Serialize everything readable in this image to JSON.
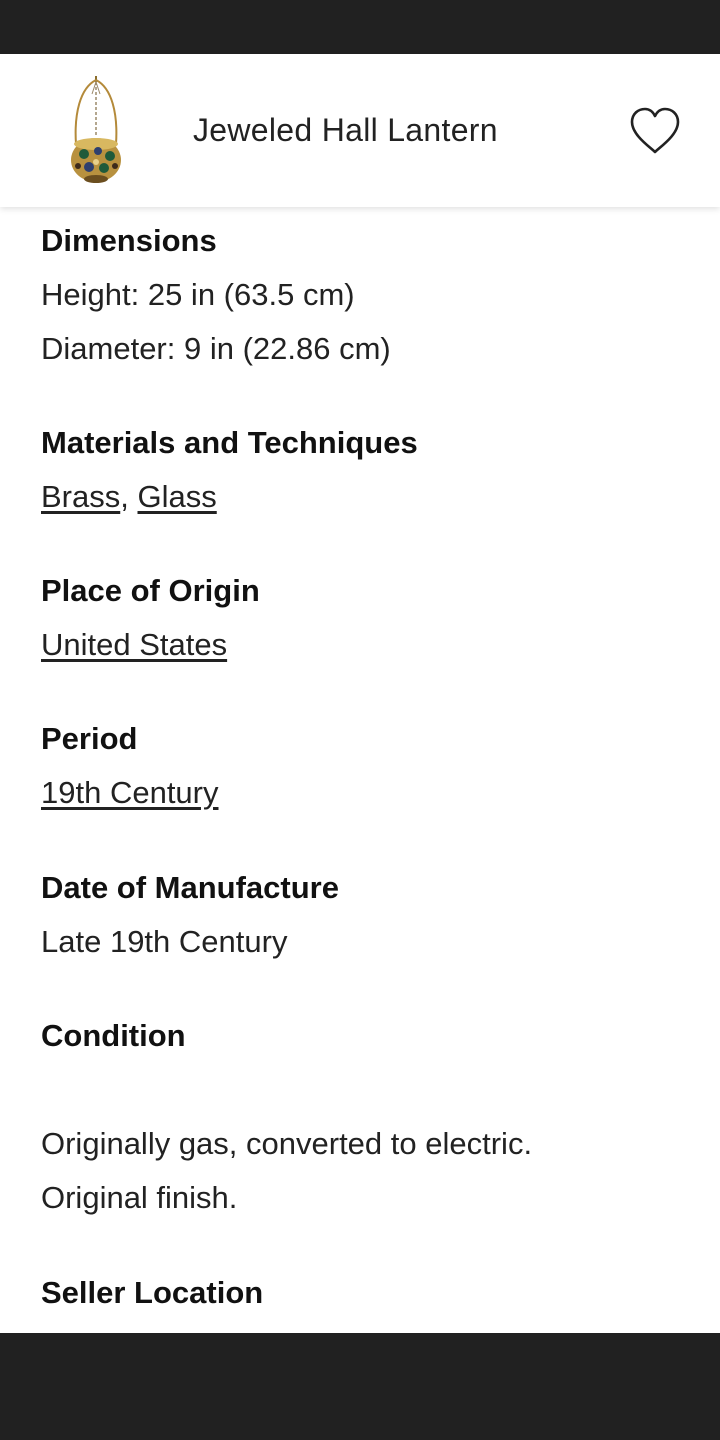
{
  "header": {
    "title": "Jeweled Hall Lantern",
    "thumbnail_icon": "lantern-thumbnail",
    "favorite_icon": "heart-outline-icon"
  },
  "details": {
    "dimensions": {
      "label": "Dimensions",
      "height": "Height: 25 in (63.5 cm)",
      "diameter": "Diameter: 9 in (22.86 cm)"
    },
    "materials": {
      "label": "Materials and Techniques",
      "items": [
        "Brass",
        "Glass"
      ],
      "separator": ","
    },
    "origin": {
      "label": "Place of Origin",
      "value": "United States"
    },
    "period": {
      "label": "Period",
      "value": "19th Century"
    },
    "date": {
      "label": "Date of Manufacture",
      "value": "Late 19th Century"
    },
    "condition": {
      "label": "Condition",
      "line1": "Originally gas, converted to electric.",
      "line2": "Original finish."
    },
    "seller_location": {
      "label": "Seller Location"
    }
  },
  "colors": {
    "system_bar": "#212121",
    "text": "#222222",
    "background": "#ffffff"
  }
}
